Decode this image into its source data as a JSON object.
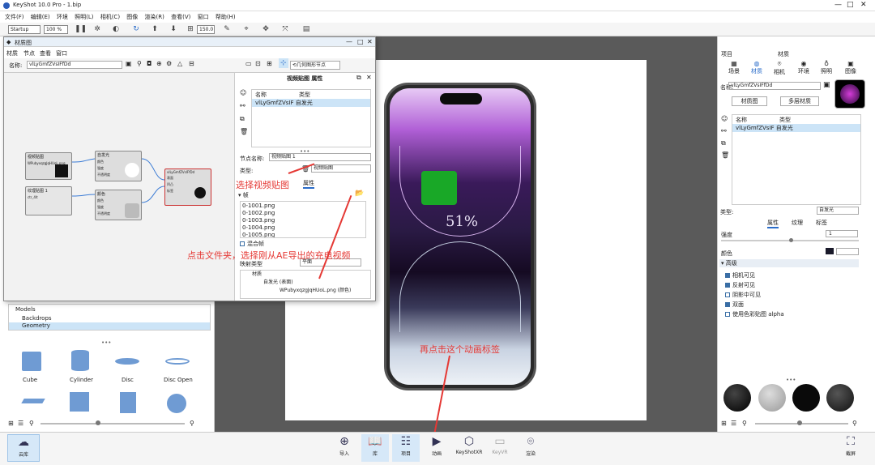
{
  "window": {
    "title": "KeyShot 10.0 Pro  -  1.bip"
  },
  "menu": [
    "文件(F)",
    "编辑(E)",
    "环境",
    "照明(L)",
    "相机(C)",
    "图像",
    "渲染(R)",
    "查看(V)",
    "窗口",
    "帮助(H)"
  ],
  "toolbar": {
    "workspace": "Startup",
    "zoom": "100 %",
    "size_value": "150.0"
  },
  "dialog": {
    "title": "材质图",
    "menu": [
      "材质",
      "节点",
      "查看",
      "窗口"
    ],
    "name_label": "名称:",
    "name_value": "vlLyGmfZVsIFfDd",
    "geo_node_button": "几何图形节点",
    "props_title": "视频贴图  属性",
    "col_name": "名称",
    "col_type": "类型",
    "list_item": "vlLyGmfZVsIF 自发光",
    "node_name_label": "节点名称:",
    "node_name_value": "视频贴图 1",
    "type_label": "类型:",
    "type_value": "视频贴图",
    "tab_attr": "属性",
    "frames_label": "▾ 帧",
    "frames": [
      "0-1001.png",
      "0-1002.png",
      "0-1003.png",
      "0-1004.png",
      "0-1005.png"
    ],
    "mix_label": "混合帧",
    "map_type_label": "映射类型",
    "map_type_value": "平面",
    "tree": [
      "材质",
      "自发光 (表面)",
      "WPubyxqzgJqHUoL.png (颜色)"
    ],
    "nodes": {
      "video": "视频贴图",
      "video_file": "WPubyxqzgJqHUoL.png",
      "color_map": "纹理贴图 1",
      "color_file": "ctr_4lt",
      "emissive": "自发光",
      "emissive_ports": [
        "颜色",
        "强度",
        "不透明度",
        "凹凸"
      ],
      "color": "颜色",
      "color_ports": [
        "颜色",
        "强度",
        "不透明度"
      ],
      "material": "vlLyGmfZVsIFfDd",
      "material_ports": [
        "表面",
        "凹凸",
        "标签",
        "位移",
        "透明度"
      ]
    }
  },
  "left": {
    "tree": [
      "Models",
      "Backdrops",
      "Geometry"
    ],
    "shapes": [
      "Cube",
      "Cylinder",
      "Disc",
      "Disc Open"
    ]
  },
  "annotations": {
    "select_video": "选择视频贴图",
    "click_folder": "点击文件夹，选择刚从AE导出的充电视频",
    "click_anim": "再点击这个动画标签"
  },
  "viewport": {
    "battery_label": "51%"
  },
  "right": {
    "header": [
      "项目",
      "材质"
    ],
    "tabs": [
      "场景",
      "材质",
      "相机",
      "环境",
      "照明",
      "图像"
    ],
    "name_label": "名称:",
    "name_value": "vlLyGmfZVsIFfDd",
    "mat_graph_btn": "材质图",
    "multi_btn": "多层材质",
    "col_name": "名称",
    "col_type": "类型",
    "item": "vlLyGmfZVsIF 自发光",
    "type_label": "类型:",
    "type_value": "自发光",
    "subtabs": [
      "属性",
      "纹理",
      "标签"
    ],
    "intensity_label": "强度",
    "intensity_value": "1",
    "color_label": "颜色",
    "advanced_label": "▾ 高级",
    "checks": [
      {
        "label": "相机可见",
        "on": true
      },
      {
        "label": "反射可见",
        "on": true
      },
      {
        "label": "阴影中可见",
        "on": false
      },
      {
        "label": "双面",
        "on": true
      },
      {
        "label": "使用色彩贴图 alpha",
        "on": false
      }
    ]
  },
  "bottom": {
    "cloud": "云库",
    "items": [
      "导入",
      "库",
      "项目",
      "动画",
      "KeyShotXR",
      "KeyVR",
      "渲染"
    ],
    "screenshot": "截屏"
  }
}
